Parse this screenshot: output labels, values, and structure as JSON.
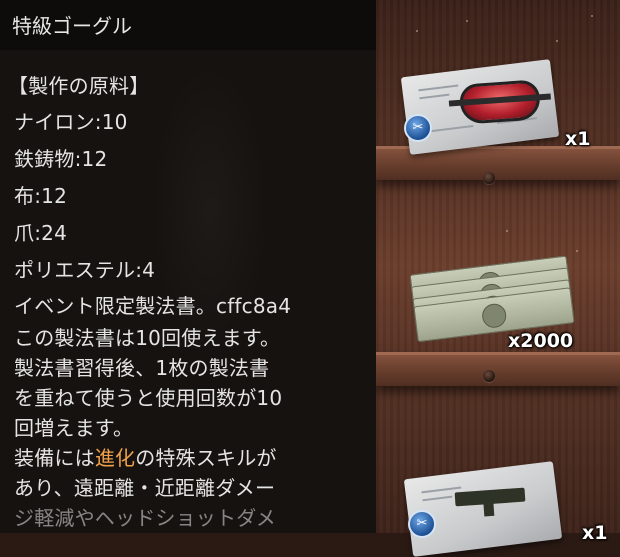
{
  "tooltip": {
    "title": "特級ゴーグル",
    "section_header": "【製作の原料】",
    "materials": [
      {
        "name": "ナイロン",
        "qty": "10"
      },
      {
        "name": "鉄鋳物",
        "qty": "12"
      },
      {
        "name": "布",
        "qty": "12"
      },
      {
        "name": "爪",
        "qty": "24"
      },
      {
        "name": "ポリエステル",
        "qty": "4"
      }
    ],
    "material_lines": [
      "ナイロン:10",
      "鉄鋳物:12",
      "布:12",
      "爪:24",
      "ポリエステル:4"
    ],
    "description_lines": [
      "イベント限定製法書。cffc8a4",
      "この製法書は10回使えます。",
      "製法書習得後、1枚の製法書",
      "を重ねて使うと使用回数が10",
      "回増えます。"
    ],
    "skill_line_prefix": "装備には",
    "skill_highlight": "進化",
    "skill_line_suffix": "の特殊スキルが",
    "skill_line_2": "あり、遠距離・近距離ダメー",
    "skill_line_3_partial": "ジ軽減やヘッドショットダメ",
    "highlight_color": "#f0a04a"
  },
  "shelf": {
    "items": [
      {
        "icon": "goggle-recipe-icon",
        "qty_label": "x1"
      },
      {
        "icon": "cash-stack-icon",
        "qty_label": "x2000"
      },
      {
        "icon": "gun-recipe-icon",
        "qty_label": "x1"
      }
    ]
  }
}
